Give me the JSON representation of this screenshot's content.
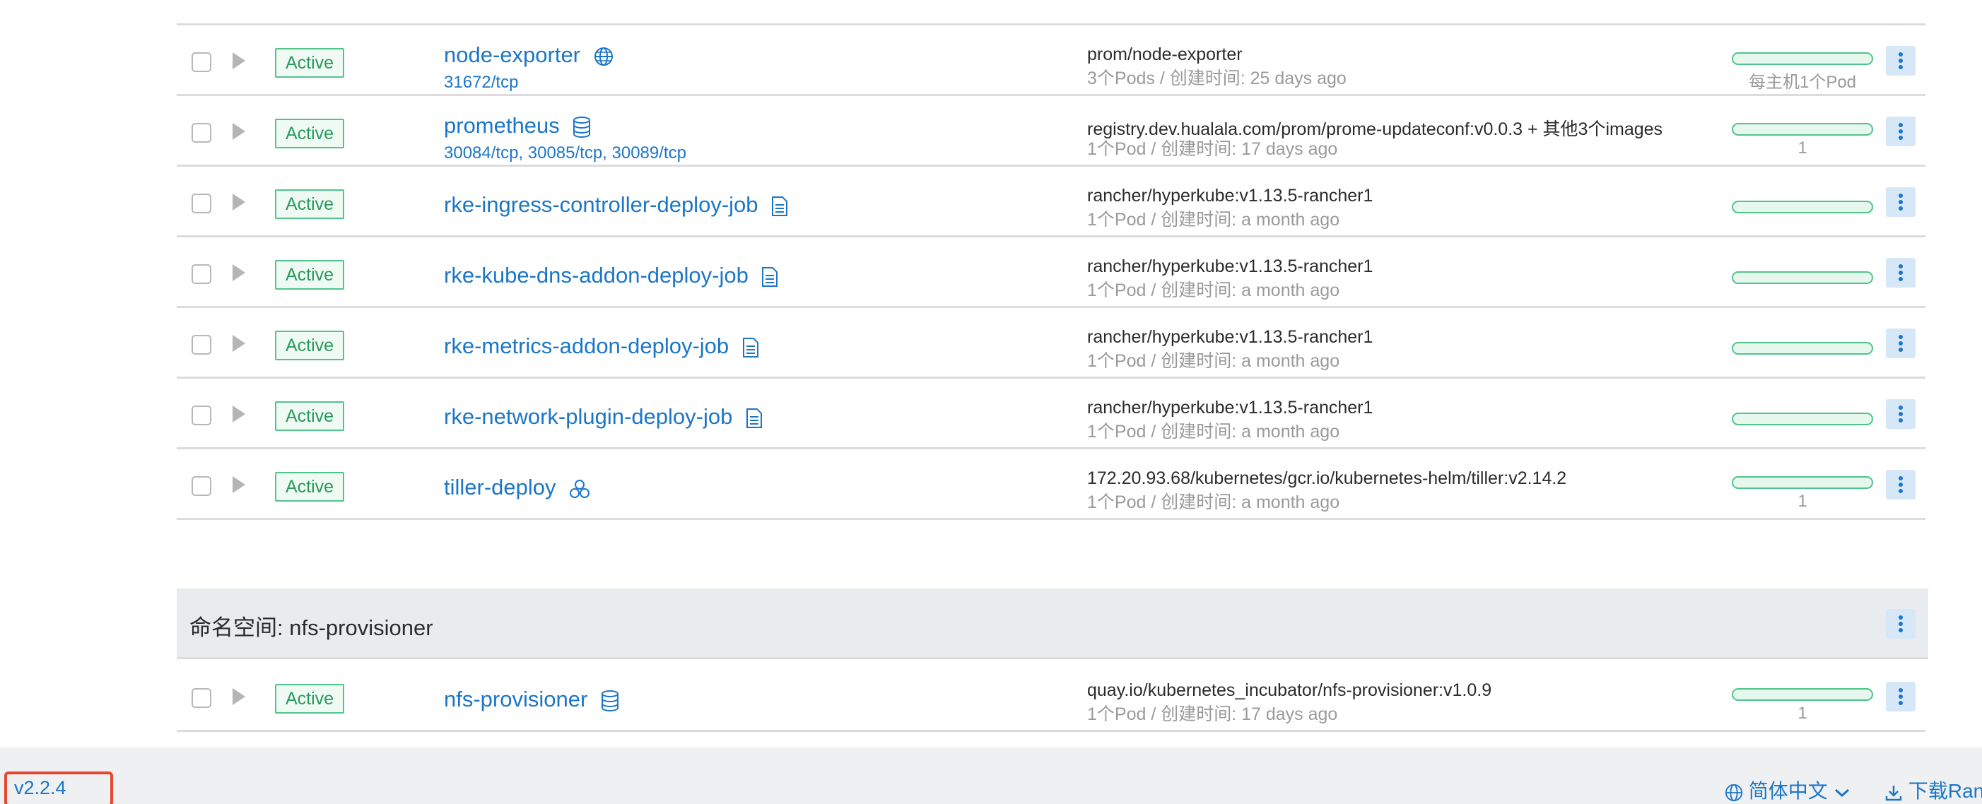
{
  "rows": [
    {
      "status": "Active",
      "name": "node-exporter",
      "icon": "globe-icon",
      "ports": "31672/tcp",
      "image": "prom/node-exporter",
      "meta": "3个Pods / 创建时间: 25 days ago",
      "scale": "每主机1个Pod"
    },
    {
      "status": "Active",
      "name": "prometheus",
      "icon": "database-icon",
      "ports": "30084/tcp, 30085/tcp, 30089/tcp",
      "image": "registry.dev.hualala.com/prom/prome-updateconf:v0.0.3 + 其他3个images",
      "meta": "1个Pod / 创建时间: 17 days ago",
      "scale": "1"
    },
    {
      "status": "Active",
      "name": "rke-ingress-controller-deploy-job",
      "icon": "file-icon",
      "ports": "",
      "image": "rancher/hyperkube:v1.13.5-rancher1",
      "meta": "1个Pod / 创建时间: a month ago",
      "scale": ""
    },
    {
      "status": "Active",
      "name": "rke-kube-dns-addon-deploy-job",
      "icon": "file-icon",
      "ports": "",
      "image": "rancher/hyperkube:v1.13.5-rancher1",
      "meta": "1个Pod / 创建时间: a month ago",
      "scale": ""
    },
    {
      "status": "Active",
      "name": "rke-metrics-addon-deploy-job",
      "icon": "file-icon",
      "ports": "",
      "image": "rancher/hyperkube:v1.13.5-rancher1",
      "meta": "1个Pod / 创建时间: a month ago",
      "scale": ""
    },
    {
      "status": "Active",
      "name": "rke-network-plugin-deploy-job",
      "icon": "file-icon",
      "ports": "",
      "image": "rancher/hyperkube:v1.13.5-rancher1",
      "meta": "1个Pod / 创建时间: a month ago",
      "scale": ""
    },
    {
      "status": "Active",
      "name": "tiller-deploy",
      "icon": "cluster-icon",
      "ports": "",
      "image": "172.20.93.68/kubernetes/gcr.io/kubernetes-helm/tiller:v2.14.2",
      "meta": "1个Pod / 创建时间: a month ago",
      "scale": "1"
    }
  ],
  "namespace": {
    "title": "命名空间: nfs-provisioner",
    "rows": [
      {
        "status": "Active",
        "name": "nfs-provisioner",
        "icon": "database-icon",
        "image": "quay.io/kubernetes_incubator/nfs-provisioner:v1.0.9",
        "meta": "1个Pod / 创建时间: 17 days ago",
        "scale": "1"
      }
    ]
  },
  "footer": {
    "version": "v2.2.4",
    "language": "简体中文",
    "download": "下载Ran"
  },
  "colors": {
    "link": "#1b76c8",
    "active": "#51c48c",
    "highlight": "#e8472f"
  }
}
